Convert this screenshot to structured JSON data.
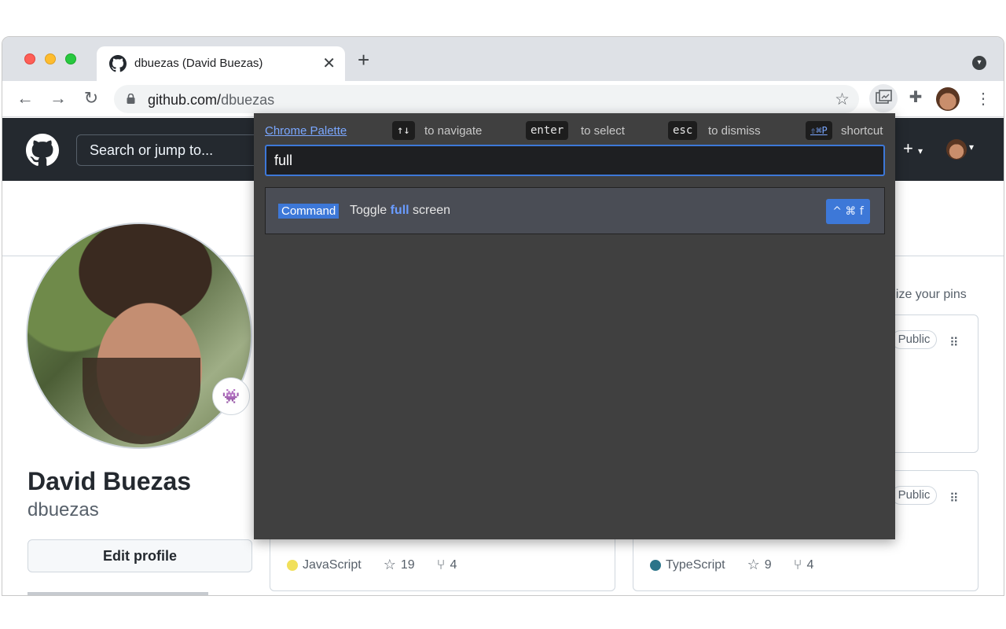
{
  "browser": {
    "tab_title": "dbuezas (David Buezas)",
    "tab_close": "✕",
    "new_tab": "+",
    "url_host": "github.com/",
    "url_path": "dbuezas"
  },
  "github": {
    "search_placeholder": "Search or jump to...",
    "create_icon": "+",
    "caret": "▾",
    "display_name": "David Buezas",
    "username": "dbuezas",
    "edit_profile": "Edit profile",
    "customize_pins": "nize your pins",
    "pins": [
      {
        "visibility": "Public"
      },
      {
        "visibility": "Public",
        "language": "TypeScript",
        "language_color": "#3178c6",
        "stars": "9",
        "forks": "4"
      },
      {
        "language": "JavaScript",
        "language_color": "#f1e05a",
        "stars": "19",
        "forks": "4"
      }
    ]
  },
  "palette": {
    "title_link": "Chrome Palette",
    "nav_key": "↑↓",
    "nav_hint": "to navigate",
    "enter_key": "enter",
    "enter_hint": "to select",
    "esc_key": "esc",
    "esc_hint": "to dismiss",
    "shortcut_key": "⇧⌘P",
    "shortcut_hint": "shortcut",
    "input_value": "full",
    "result": {
      "badge": "Command",
      "text_before": "Toggle ",
      "text_match": "full",
      "text_after": " screen",
      "shortcut": "^ ⌘ f"
    }
  },
  "colors": {
    "accent": "#3d78d8",
    "header_bg": "#24292f",
    "palette_bg": "#404040"
  },
  "icons": [
    "github-logo-icon",
    "lock-icon",
    "star-icon",
    "puzzle-icon",
    "kebab-menu-icon",
    "back-arrow-icon",
    "forward-arrow-icon",
    "reload-icon",
    "fork-icon"
  ]
}
